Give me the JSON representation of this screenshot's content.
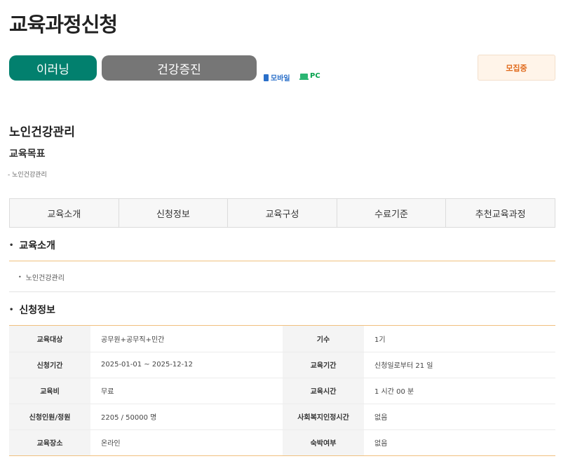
{
  "page": {
    "title": "교육과정신청"
  },
  "categories": {
    "elearning": "이러닝",
    "health": "건강증진"
  },
  "devices": {
    "mobile": "모바일",
    "pc": "PC"
  },
  "status": "모집중",
  "course": {
    "name": "노인건강관리",
    "goal_heading": "교육목표",
    "goal_text": "- 노인건강관리"
  },
  "tabs": [
    "교육소개",
    "신청정보",
    "교육구성",
    "수료기준",
    "추천교육과정"
  ],
  "sections": {
    "intro": {
      "title": "교육소개",
      "items": [
        "노인건강관리"
      ]
    },
    "info": {
      "title": "신청정보"
    }
  },
  "info_rows": [
    {
      "label1": "교육대상",
      "value1": "공무원+공무직+민간",
      "label2": "기수",
      "value2": "1기"
    },
    {
      "label1": "신청기간",
      "value1": "2025-01-01 ~ 2025-12-12",
      "label2": "교육기간",
      "value2": "신청일로부터 21 일"
    },
    {
      "label1": "교육비",
      "value1": "무료",
      "label2": "교육시간",
      "value2": "1 시간 00 분"
    },
    {
      "label1": "신청인원/정원",
      "value1": "2205 / 50000 명",
      "label2": "사회복지인정시간",
      "value2": "없음"
    },
    {
      "label1": "교육장소",
      "value1": "온라인",
      "label2": "숙박여부",
      "value2": "없음"
    }
  ]
}
